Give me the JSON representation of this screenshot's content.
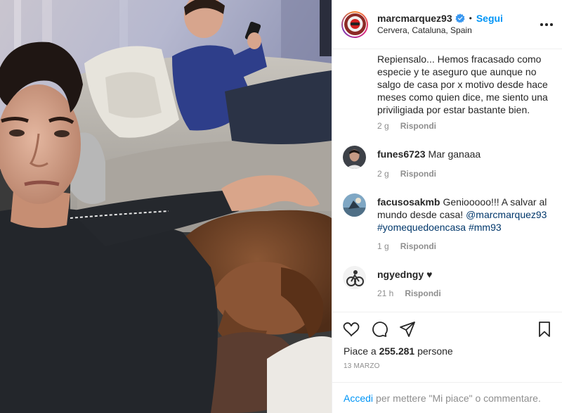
{
  "post": {
    "username": "marcmarquez93",
    "follow_label": "Segui",
    "separator": "•",
    "location": "Cervera, Cataluna, Spain",
    "more_icon": "more-options-icon",
    "verified_icon": "verified-badge-icon"
  },
  "comments": [
    {
      "user": "",
      "text": "Repiensalo... Hemos fracasado como especie y te aseguro que aunque no salgo de casa por x motivo desde hace meses como quien dice, me siento una priviligiada por estar bastante bien.",
      "time": "2 g",
      "reply_label": "Rispondi"
    },
    {
      "user": "funes6723",
      "text": "Mar ganaaa",
      "time": "2 g",
      "reply_label": "Rispondi"
    },
    {
      "user": "facusosakmb",
      "text": "Geniooooo!!! A salvar al mundo desde casa! ",
      "mention": "@marcmarquez93",
      "hashtags": "#yomequedoencasa #mm93",
      "time": "1 g",
      "reply_label": "Rispondi"
    },
    {
      "user": "ngyedngy",
      "text": "♥",
      "time": "21 h",
      "reply_label": "Rispondi"
    }
  ],
  "actions": {
    "icons": [
      "heart-icon",
      "comment-icon",
      "share-icon",
      "bookmark-icon"
    ]
  },
  "likes": {
    "prefix": "Piace a ",
    "count": "255.281",
    "suffix": " persone"
  },
  "date": "13 MARZO",
  "login": {
    "link_label": "Accedi",
    "text": "per mettere \"Mi piace\" o commentare."
  },
  "colors": {
    "link_blue": "#0095f6",
    "mention_blue": "#00376b",
    "meta_gray": "#8e8e8e",
    "text": "#262626",
    "divider": "#efefef"
  }
}
